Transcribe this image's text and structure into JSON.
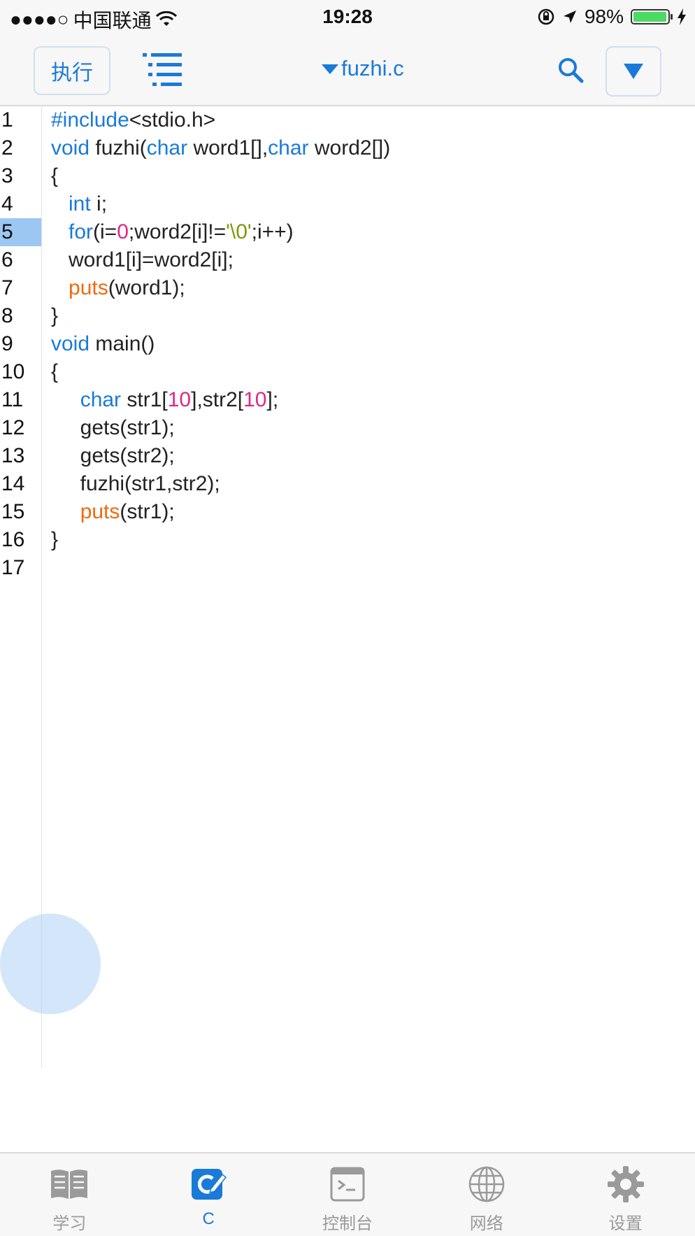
{
  "status_bar": {
    "signal": "●●●●○",
    "carrier": "中国联通",
    "time": "19:28",
    "battery_percent": "98%",
    "battery_level": 0.98
  },
  "toolbar": {
    "run_label": "执行",
    "file_name": "fuzhi.c"
  },
  "editor": {
    "active_line": 5,
    "line_numbers": [
      "1",
      "2",
      "3",
      "4",
      "5",
      "6",
      "7",
      "8",
      "9",
      "10",
      "11",
      "12",
      "13",
      "14",
      "15",
      "16",
      "17"
    ]
  },
  "tab_bar": {
    "items": [
      {
        "label": "学习",
        "icon": "book-icon"
      },
      {
        "label": "C",
        "icon": "c-code-icon",
        "active": true
      },
      {
        "label": "控制台",
        "icon": "terminal-icon"
      },
      {
        "label": "网络",
        "icon": "globe-icon"
      },
      {
        "label": "设置",
        "icon": "gear-icon"
      }
    ]
  },
  "colors": {
    "accent": "#1a7ad8",
    "keyword": "#1a7ad8",
    "function": "#f06a0f",
    "number": "#e0268a",
    "string": "#7a9a0a",
    "active_line": "#9cc7f2"
  }
}
